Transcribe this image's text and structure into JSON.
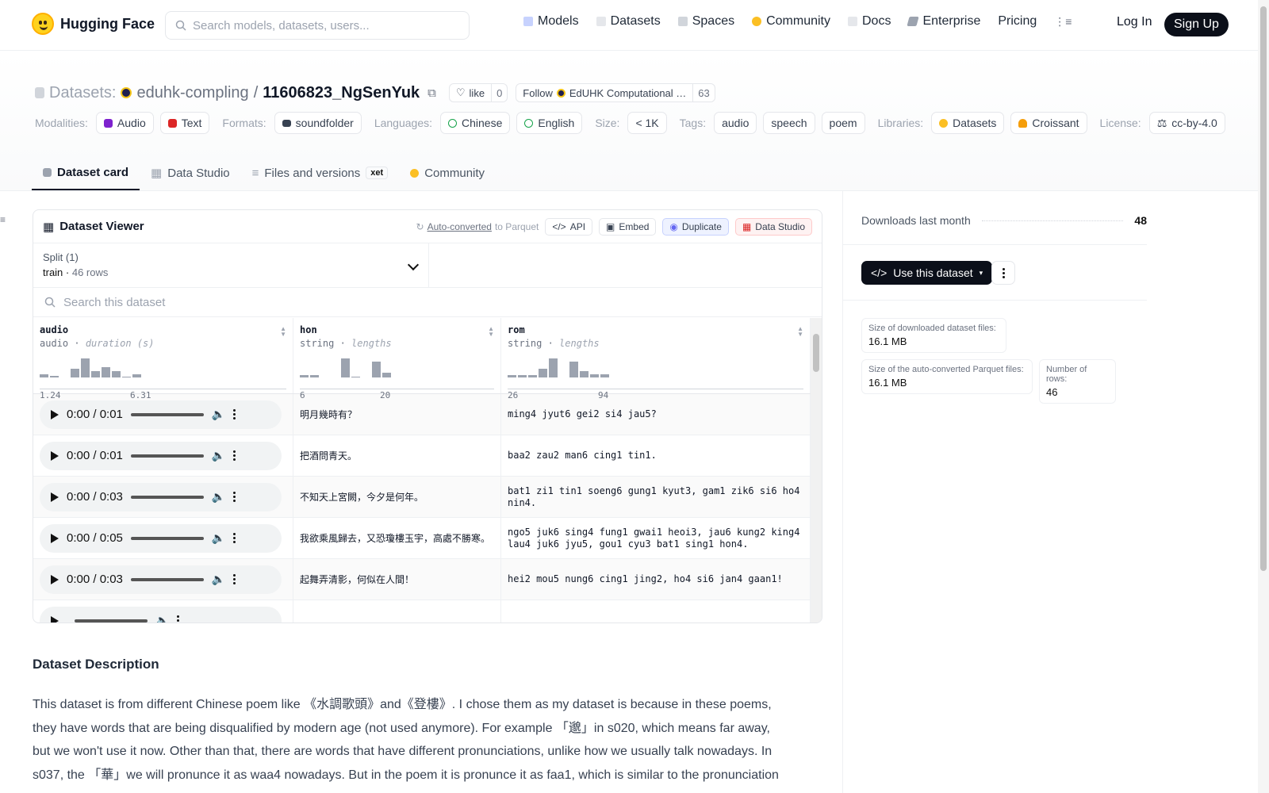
{
  "nav": {
    "brand": "Hugging Face",
    "search_placeholder": "Search models, datasets, users...",
    "links": [
      "Models",
      "Datasets",
      "Spaces",
      "Community",
      "Docs",
      "Enterprise",
      "Pricing"
    ],
    "login": "Log In",
    "signup": "Sign Up"
  },
  "repo": {
    "type_label": "Datasets:",
    "org": "eduhk-compling",
    "sep": "/",
    "name": "11606823_NgSenYuk",
    "like_label": "like",
    "like_count": "0",
    "follow_label": "Follow",
    "follow_org": "EdUHK Computational …",
    "follow_count": "63"
  },
  "meta": {
    "modalities_label": "Modalities:",
    "modalities": [
      "Audio",
      "Text"
    ],
    "formats_label": "Formats:",
    "formats": [
      "soundfolder"
    ],
    "languages_label": "Languages:",
    "languages": [
      "Chinese",
      "English"
    ],
    "size_label": "Size:",
    "size": "< 1K",
    "tags_label": "Tags:",
    "tags": [
      "audio",
      "speech",
      "poem"
    ],
    "libraries_label": "Libraries:",
    "libraries": [
      "Datasets",
      "Croissant"
    ],
    "license_label": "License:",
    "license": "cc-by-4.0"
  },
  "tabs": [
    "Dataset card",
    "Data Studio",
    "Files and versions",
    "Community"
  ],
  "xet_badge": "xet",
  "viewer": {
    "title": "Dataset Viewer",
    "auto_converted": "Auto-converted",
    "to_parquet": "to Parquet",
    "api": "API",
    "embed": "Embed",
    "duplicate": "Duplicate",
    "data_studio": "Data Studio",
    "split_label": "Split (1)",
    "split_value": "train",
    "split_rows": "46 rows",
    "search_placeholder": "Search this dataset",
    "columns": [
      {
        "name": "audio",
        "type": "audio",
        "subtype": "duration (s)",
        "min": "1.24",
        "max": "6.31",
        "hist": [
          0.15,
          0.07,
          0,
          0.4,
          0.85,
          0.3,
          0.45,
          0.3,
          0.05,
          0.15
        ]
      },
      {
        "name": "hon",
        "type": "string",
        "subtype": "lengths",
        "min": "6",
        "max": "20",
        "hist": [
          0.1,
          0.1,
          0,
          0,
          0.85,
          0.05,
          0,
          0.7,
          0.2
        ]
      },
      {
        "name": "rom",
        "type": "string",
        "subtype": "lengths",
        "min": "26",
        "max": "94",
        "hist": [
          0.1,
          0.1,
          0.1,
          0.4,
          0.85,
          0,
          0.7,
          0.3,
          0.15,
          0.15
        ]
      }
    ],
    "rows": [
      {
        "time": "0:00 / 0:01",
        "hon": "明月幾時有？",
        "rom": "ming4 jyut6 gei2 si4 jau5?"
      },
      {
        "time": "0:00 / 0:01",
        "hon": "把酒問青天。",
        "rom": "baa2 zau2 man6 cing1 tin1."
      },
      {
        "time": "0:00 / 0:03",
        "hon": "不知天上宮闕，今夕是何年。",
        "rom": "bat1 zi1 tin1 soeng6 gung1 kyut3, gam1 zik6 si6 ho4 nin4."
      },
      {
        "time": "0:00 / 0:05",
        "hon": "我欲乘風歸去，又恐瓊樓玉宇，高處不勝寒。",
        "rom": "ngo5 juk6 sing4 fung1 gwai1 heoi3, jau6 kung2 king4 lau4 juk6 jyu5, gou1 cyu3 bat1 sing1 hon4."
      },
      {
        "time": "0:00 / 0:03",
        "hon": "起舞弄清影，何似在人間！",
        "rom": "hei2 mou5 nung6 cing1 jing2, ho4 si6 jan4 gaan1!"
      }
    ]
  },
  "sidebar": {
    "downloads_label": "Downloads last month",
    "downloads": "48",
    "use_button": "Use this dataset",
    "stats": [
      {
        "label": "Size of downloaded dataset files:",
        "value": "16.1 MB"
      },
      {
        "label": "Size of the auto-converted Parquet files:",
        "value": "16.1 MB"
      },
      {
        "label": "Number of rows:",
        "value": "46"
      }
    ]
  },
  "description": {
    "title": "Dataset Description",
    "text": "This dataset is from different Chinese poem like 《水調歌頭》and《登樓》. I chose them as my dataset is because in these poems, they have words that are being disqualified by modern age (not used anymore). For example 「邈」in s020, which means far away, but we won't use it now. Other than that, there are words that have different pronunciations, unlike how we usually talk nowadays. In s037, the 「華」we will pronunce it as waa4 nowadays. But in the poem it is pronunce it as faa1, which is similar to the pronunciation"
  },
  "colors": {
    "dark": "#0b0f19",
    "hist": "#9ca3af",
    "brand": "#ffd21e"
  }
}
